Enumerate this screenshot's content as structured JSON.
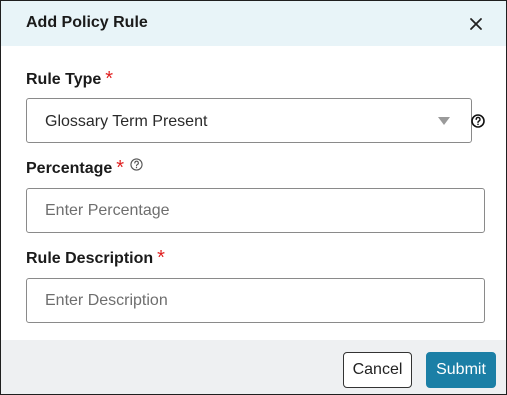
{
  "dialog": {
    "title": "Add Policy Rule",
    "close_icon": "close-icon"
  },
  "form": {
    "rule_type": {
      "label": "Rule Type",
      "required_mark": "*",
      "selected_value": "Glossary Term Present",
      "icons": [
        "chevron-down-icon",
        "help-icon"
      ]
    },
    "percentage": {
      "label": "Percentage",
      "required_mark": "*",
      "placeholder": "Enter Percentage",
      "value": "",
      "icons": [
        "help-icon"
      ]
    },
    "description": {
      "label": "Rule Description",
      "required_mark": "*",
      "placeholder": "Enter Description",
      "value": ""
    }
  },
  "footer": {
    "cancel_label": "Cancel",
    "submit_label": "Submit"
  },
  "colors": {
    "header_bg": "#e8f4f8",
    "footer_bg": "#eef0f2",
    "required": "#e02020",
    "primary": "#1b7fa6"
  }
}
